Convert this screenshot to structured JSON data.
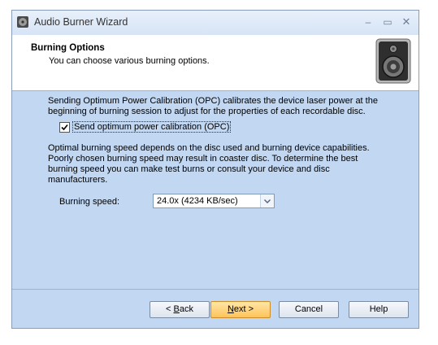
{
  "window": {
    "title": "Audio Burner Wizard",
    "controls": {
      "minimize": "–",
      "maximize": "▭",
      "close": "✕"
    }
  },
  "header": {
    "title": "Burning Options",
    "subtitle": "You can choose various burning options."
  },
  "content": {
    "opc_description": "Sending Optimum Power Calibration (OPC) calibrates the device laser power at the beginning of burning session to adjust for the properties of each recordable disc.",
    "opc_checkbox": {
      "label": "Send optimum power calibration (OPC)",
      "checked": true
    },
    "speed_description": "Optimal burning speed depends on the disc used and burning device capabilities. Poorly chosen burning speed may result in coaster disc. To determine the best burning speed you can make test burns or consult your device and disc manufacturers.",
    "speed_label": "Burning speed:",
    "speed_value": "24.0x (4234 KB/sec)"
  },
  "buttons": {
    "back": {
      "mnemonic": "B",
      "rest": "ack",
      "prefix": "< "
    },
    "next": {
      "mnemonic": "N",
      "rest": "ext >"
    },
    "cancel": "Cancel",
    "help": "Help"
  },
  "colors": {
    "dialog_bg": "#c2d7f2",
    "next_button": "#ffc35a"
  }
}
